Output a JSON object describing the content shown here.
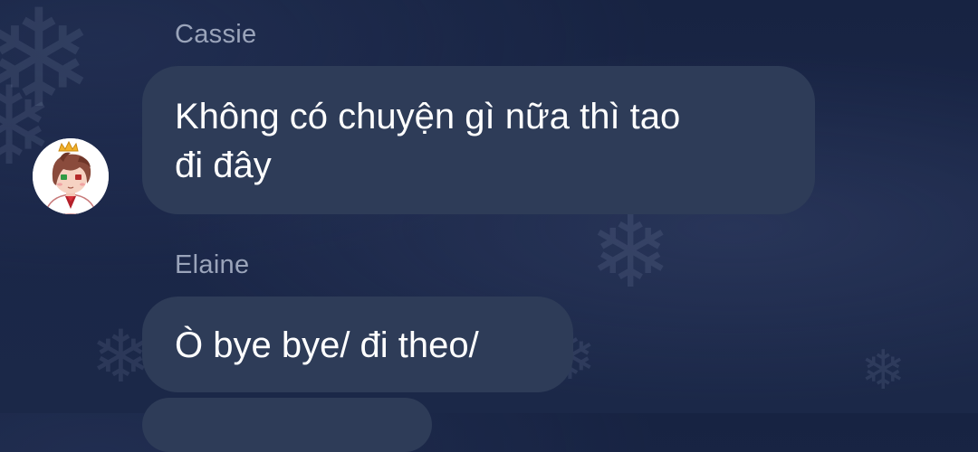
{
  "messages": [
    {
      "sender": "Cassie",
      "text": "Không có chuyện gì nữa thì tao đi đây",
      "line1": "Không có chuyện gì nữa thì tao",
      "line2": "đi đây"
    },
    {
      "sender": "Elaine",
      "text": "Ò bye bye/ đi theo/"
    }
  ],
  "colors": {
    "background": "#1a2647",
    "bubble": "#2e3c58",
    "sender_name": "#9aa4ba",
    "message_text": "#ffffff"
  }
}
